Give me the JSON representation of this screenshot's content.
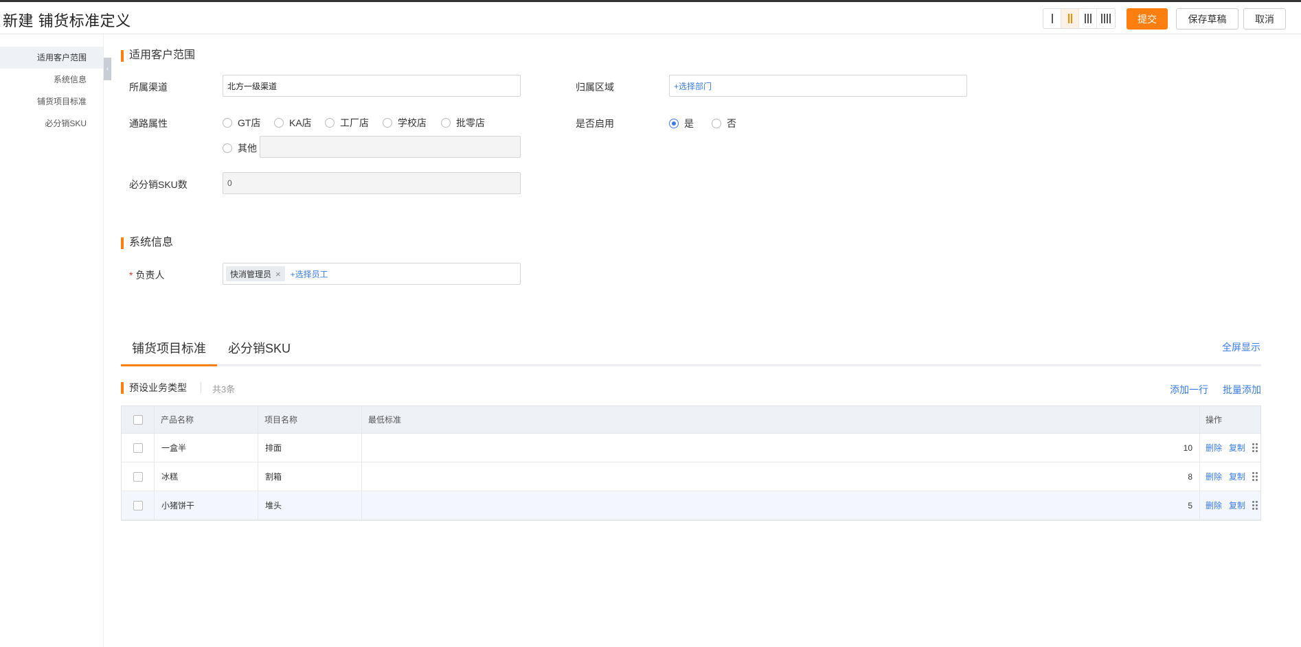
{
  "header": {
    "title": "新建 铺货标准定义",
    "submit_label": "提交",
    "save_draft_label": "保存草稿",
    "cancel_label": "取消",
    "column_layouts": [
      "1",
      "2",
      "3",
      "4"
    ],
    "active_layout": "2"
  },
  "sidebar": {
    "items": [
      {
        "label": "适用客户范围",
        "active": true
      },
      {
        "label": "系统信息",
        "active": false
      },
      {
        "label": "铺货项目标准",
        "active": false
      },
      {
        "label": "必分销SKU",
        "active": false
      }
    ]
  },
  "scope": {
    "title": "适用客户范围",
    "channel_label": "所属渠道",
    "channel_value": "北方一级渠道",
    "region_label": "归属区域",
    "region_placeholder": "+选择部门",
    "route_label": "通路属性",
    "route_options": [
      "GT店",
      "KA店",
      "工厂店",
      "学校店",
      "批零店",
      "其他"
    ],
    "enabled_label": "是否启用",
    "enabled_options": [
      "是",
      "否"
    ],
    "enabled_value": "是",
    "sku_count_label": "必分销SKU数",
    "sku_count_value": "0"
  },
  "system": {
    "title": "系统信息",
    "owner_label": "负责人",
    "owner_required": "*",
    "owner_tag": "快消管理员",
    "owner_add": "+选择员工"
  },
  "tabs": {
    "items": [
      "铺货项目标准",
      "必分销SKU"
    ],
    "active": "铺货项目标准",
    "fullscreen_label": "全屏显示"
  },
  "table": {
    "title": "预设业务类型",
    "count_text": "共3条",
    "add_row_label": "添加一行",
    "batch_add_label": "批量添加",
    "columns": [
      "产品名称",
      "项目名称",
      "最低标准",
      "操作"
    ],
    "rows": [
      {
        "product": "一盒半",
        "item": "排面",
        "min": "10",
        "delete": "删除",
        "copy": "复制"
      },
      {
        "product": "冰糕",
        "item": "割箱",
        "min": "8",
        "delete": "删除",
        "copy": "复制"
      },
      {
        "product": "小猪饼干",
        "item": "堆头",
        "min": "5",
        "delete": "删除",
        "copy": "复制"
      }
    ]
  }
}
